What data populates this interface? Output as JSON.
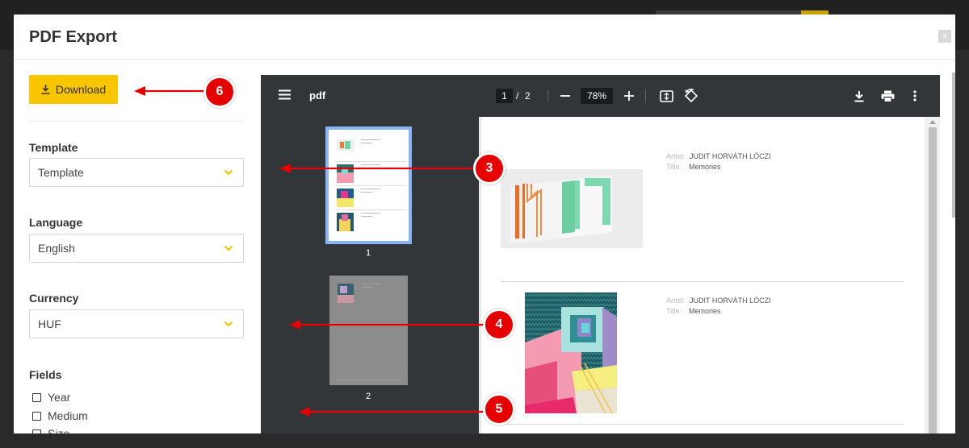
{
  "modal": {
    "title": "PDF Export",
    "close_symbol": "×"
  },
  "sidebar": {
    "download_label": "Download",
    "template": {
      "label": "Template",
      "value": "Template"
    },
    "language": {
      "label": "Language",
      "value": "English"
    },
    "currency": {
      "label": "Currency",
      "value": "HUF"
    },
    "fields": {
      "label": "Fields",
      "items": [
        {
          "label": "Year",
          "checked": false
        },
        {
          "label": "Medium",
          "checked": false
        },
        {
          "label": "Size",
          "checked": false
        }
      ]
    }
  },
  "viewer": {
    "title": "pdf",
    "page_current": "1",
    "page_separator": "/",
    "page_total": "2",
    "zoom": "78%",
    "thumbnails": [
      {
        "number": "1",
        "selected": true
      },
      {
        "number": "2",
        "selected": false
      }
    ],
    "artworks": [
      {
        "artist_label": "Artist:",
        "artist": "JUDIT HORVÁTH LÓCZI",
        "title_label": "Title:",
        "title": "Memories"
      },
      {
        "artist_label": "Artist:",
        "artist": "JUDIT HORVÁTH LÓCZI",
        "title_label": "Title:",
        "title": "Memories"
      }
    ]
  },
  "annotations": [
    "6",
    "3",
    "4",
    "5"
  ],
  "colors": {
    "accent_yellow": "#f7c600",
    "annotation_red": "#e60000",
    "viewer_toolbar": "#323639",
    "thumbnail_selected_border": "#8ab4f8"
  }
}
